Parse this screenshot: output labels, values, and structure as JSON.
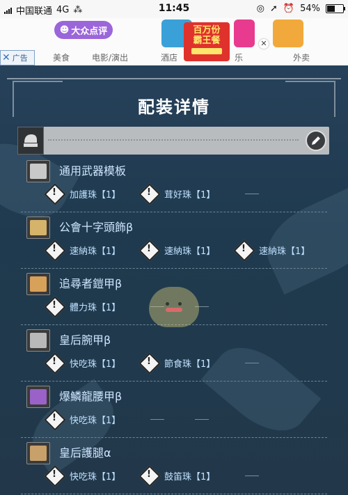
{
  "status_bar": {
    "carrier": "中国联通",
    "network": "4G",
    "time": "11:45",
    "battery": "54%",
    "battery_level": 0.54
  },
  "ad": {
    "label": "广告",
    "logo_text": "大众点评",
    "categories": [
      "美食",
      "电影/演出",
      "酒店",
      "乐",
      "外卖"
    ],
    "promo_line1": "百万份",
    "promo_line2": "霸王餐"
  },
  "page": {
    "title": "配装详情"
  },
  "pieces": [
    {
      "name": "通用武器模板",
      "icon": "weapon-icon",
      "icon_color": "#c9c9c9",
      "decos": [
        {
          "name": "加護珠【1】"
        },
        {
          "name": "茸好珠【1】"
        }
      ],
      "empty_slots": 1
    },
    {
      "name": "公會十字頭飾β",
      "icon": "helmet-icon",
      "icon_color": "#d6b36a",
      "decos": [
        {
          "name": "速納珠【1】"
        },
        {
          "name": "速納珠【1】"
        },
        {
          "name": "速納珠【1】"
        }
      ],
      "empty_slots": 0
    },
    {
      "name": "追尋者鎧甲β",
      "icon": "chest-icon",
      "icon_color": "#d8a15a",
      "decos": [
        {
          "name": "體力珠【1】"
        }
      ],
      "empty_slots": 2
    },
    {
      "name": "皇后腕甲β",
      "icon": "arm-icon",
      "icon_color": "#b9b9b9",
      "decos": [
        {
          "name": "快吃珠【1】"
        },
        {
          "name": "節食珠【1】"
        }
      ],
      "empty_slots": 1
    },
    {
      "name": "爆鱗龍腰甲β",
      "icon": "waist-icon",
      "icon_color": "#9a62c8",
      "decos": [
        {
          "name": "快吃珠【1】"
        }
      ],
      "empty_slots": 2
    },
    {
      "name": "皇后護腿α",
      "icon": "leg-icon",
      "icon_color": "#c8a06a",
      "decos": [
        {
          "name": "快吃珠【1】"
        },
        {
          "name": "鼓笛珠【1】"
        }
      ],
      "empty_slots": 1
    }
  ],
  "colors": {
    "accent_text": "#cfe6ff",
    "background": "#1f3a4e"
  }
}
